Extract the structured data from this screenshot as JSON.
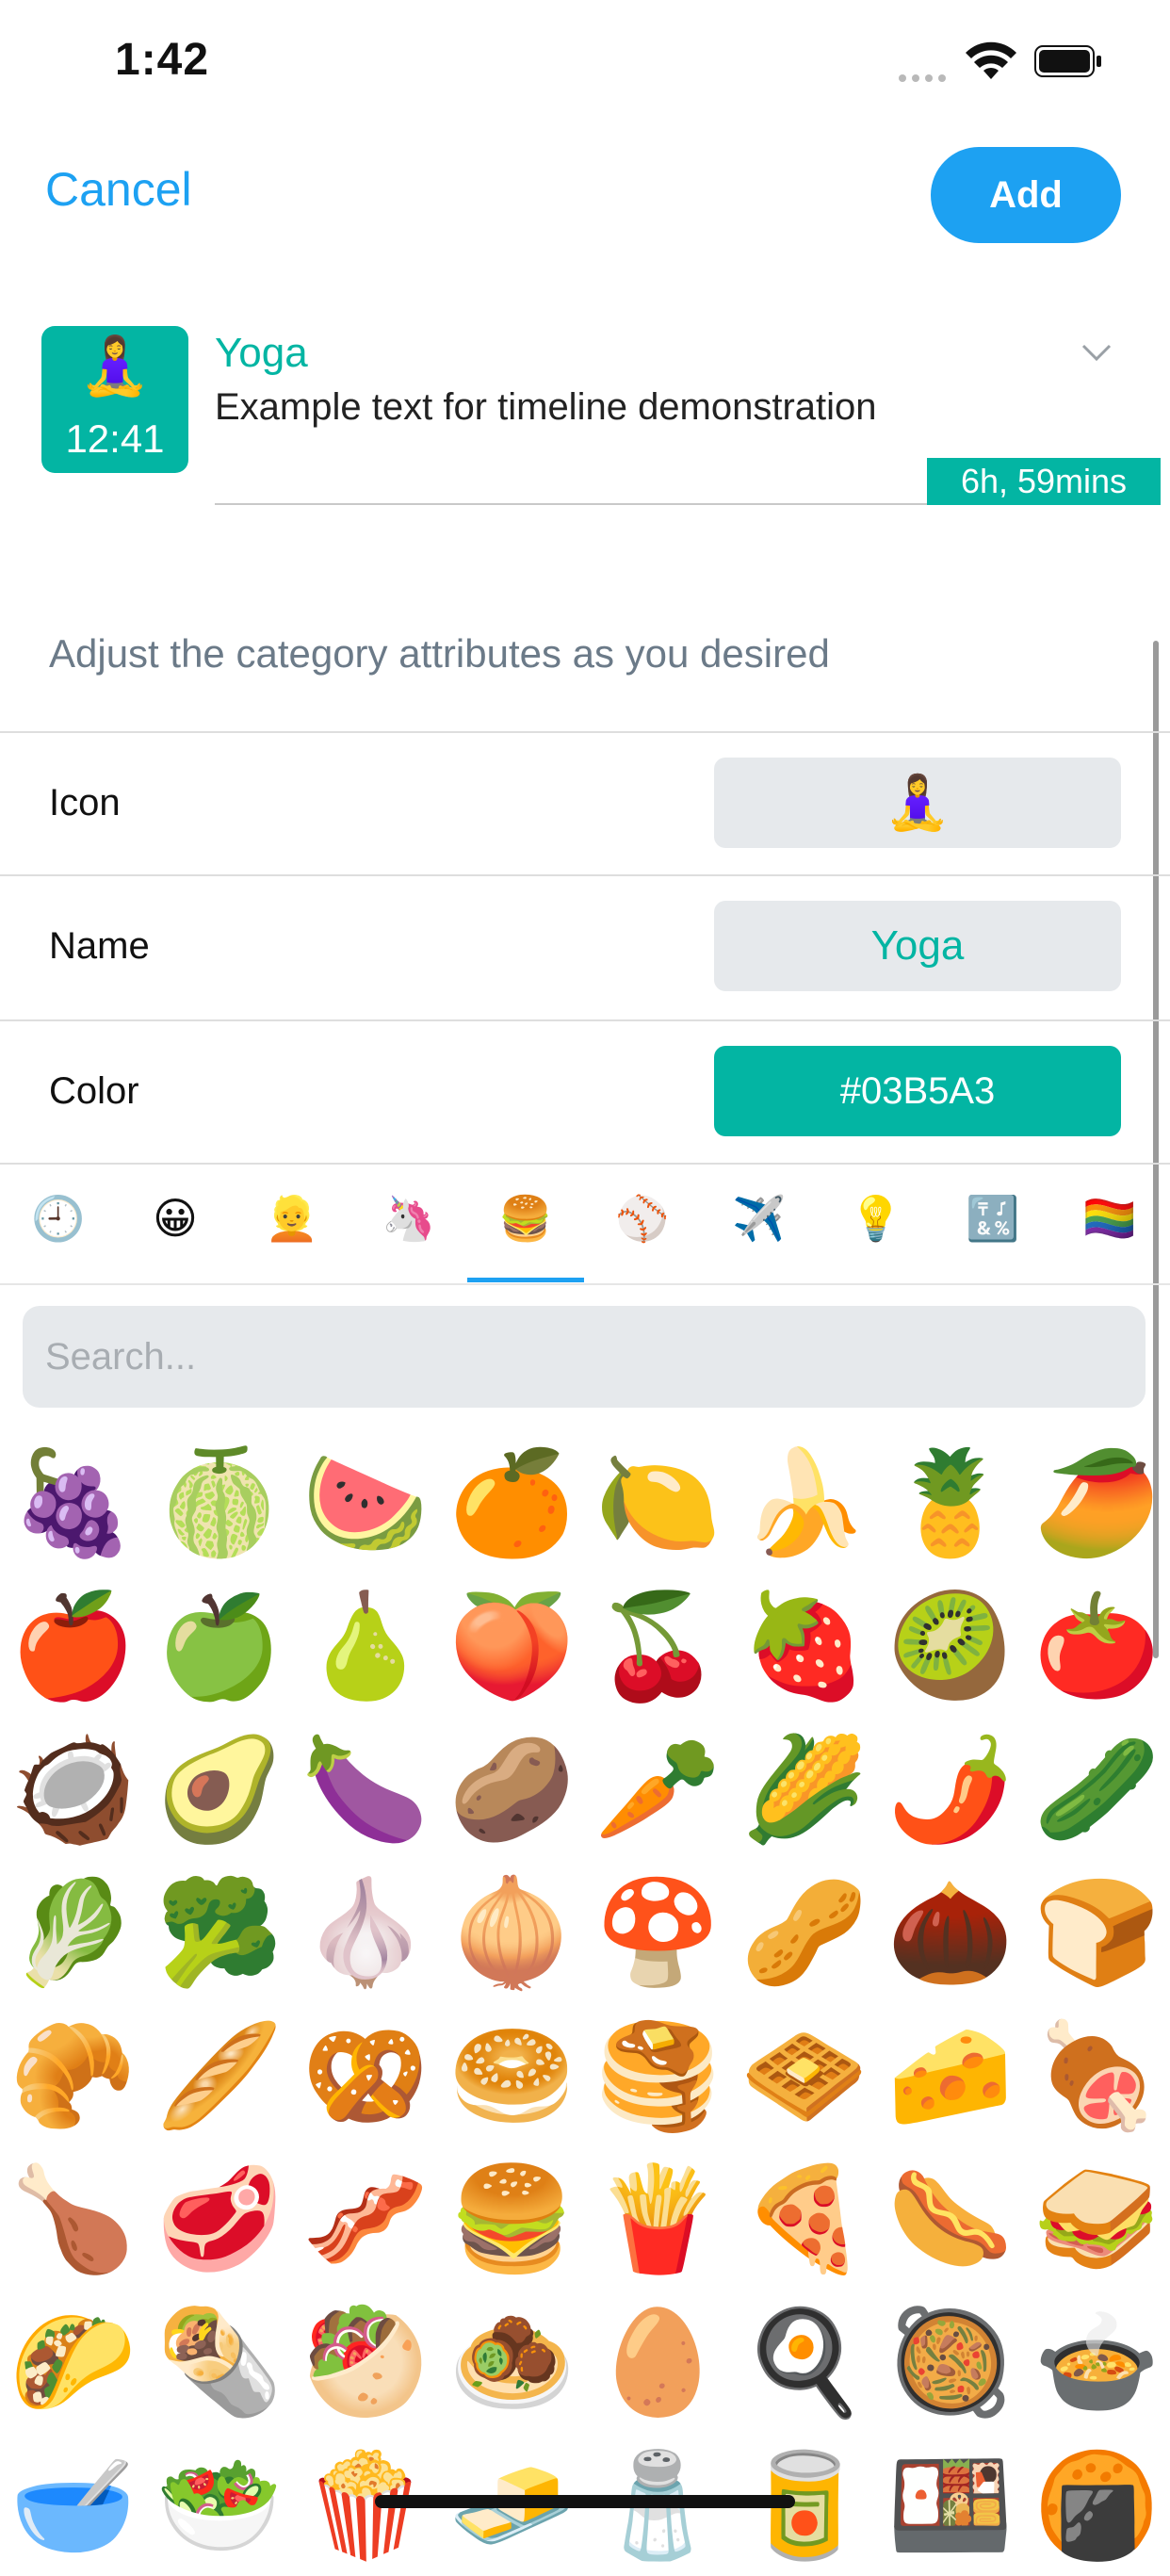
{
  "status_bar": {
    "time": "1:42"
  },
  "nav": {
    "cancel_label": "Cancel",
    "add_label": "Add"
  },
  "preview": {
    "icon_emoji": "🧘‍♀️",
    "icon_time": "12:41",
    "title": "Yoga",
    "description": "Example text for timeline demonstration",
    "duration": "6h, 59mins"
  },
  "attributes": {
    "hint": "Adjust the category attributes as you desired",
    "icon": {
      "label": "Icon",
      "value": "🧘‍♀️"
    },
    "name": {
      "label": "Name",
      "value": "Yoga"
    },
    "color": {
      "label": "Color",
      "value": "#03B5A3"
    }
  },
  "emoji_tabs": {
    "selected_index": 4,
    "items": [
      {
        "name": "recent",
        "glyph": "🕘"
      },
      {
        "name": "smileys",
        "glyph": "😀"
      },
      {
        "name": "people",
        "glyph": "👱"
      },
      {
        "name": "animals",
        "glyph": "🦄"
      },
      {
        "name": "food",
        "glyph": "🍔"
      },
      {
        "name": "activity",
        "glyph": "⚾"
      },
      {
        "name": "travel",
        "glyph": "✈️"
      },
      {
        "name": "objects",
        "glyph": "💡"
      },
      {
        "name": "symbols",
        "glyph": "🔣"
      },
      {
        "name": "flags",
        "glyph": "🏳️‍🌈"
      }
    ]
  },
  "search": {
    "placeholder": "Search..."
  },
  "emoji_grid": [
    [
      "🍇",
      "🍈",
      "🍉",
      "🍊",
      "🍋",
      "🍌",
      "🍍",
      "🥭"
    ],
    [
      "🍎",
      "🍏",
      "🍐",
      "🍑",
      "🍒",
      "🍓",
      "🥝",
      "🍅"
    ],
    [
      "🥥",
      "🥑",
      "🍆",
      "🥔",
      "🥕",
      "🌽",
      "🌶️",
      "🥒"
    ],
    [
      "🥬",
      "🥦",
      "🧄",
      "🧅",
      "🍄",
      "🥜",
      "🌰",
      "🍞"
    ],
    [
      "🥐",
      "🥖",
      "🥨",
      "🥯",
      "🥞",
      "🧇",
      "🧀",
      "🍖"
    ],
    [
      "🍗",
      "🥩",
      "🥓",
      "🍔",
      "🍟",
      "🍕",
      "🌭",
      "🥪"
    ],
    [
      "🌮",
      "🌯",
      "🥙",
      "🧆",
      "🥚",
      "🍳",
      "🥘",
      "🍲"
    ],
    [
      "🥣",
      "🥗",
      "🍿",
      "🧈",
      "🧂",
      "🥫",
      "🍱",
      "🍘"
    ]
  ],
  "colors": {
    "accent": "#1da1f2",
    "category": "#03b5a3"
  }
}
